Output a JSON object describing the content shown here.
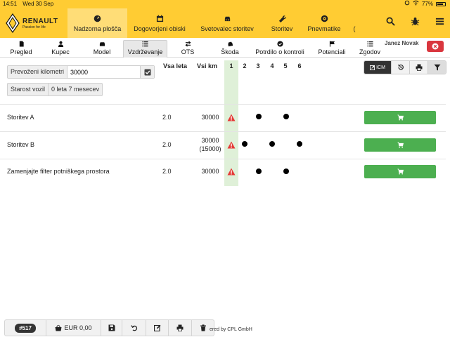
{
  "status_bar": {
    "time": "14:51",
    "date": "Wed 30 Sep",
    "battery": "77%"
  },
  "brand": {
    "name": "RENAULT",
    "slogan": "Passion for life"
  },
  "nav": [
    {
      "label": "Nadzorna plošča",
      "icon": "gauge-icon",
      "active": true
    },
    {
      "label": "Dogovorjeni obiski",
      "icon": "calendar-icon",
      "active": false
    },
    {
      "label": "Svetovalec storitev",
      "icon": "car-front-icon",
      "active": false
    },
    {
      "label": "Storitev",
      "icon": "wrench-icon",
      "active": false
    },
    {
      "label": "Pnevmatike",
      "icon": "tire-icon",
      "active": false
    },
    {
      "label": "(",
      "icon": "",
      "active": false
    }
  ],
  "tabs": [
    {
      "label": "Pregled",
      "icon": "document-icon",
      "active": false
    },
    {
      "label": "Kupec",
      "icon": "user-icon",
      "active": false
    },
    {
      "label": "Model",
      "icon": "car-icon",
      "active": false
    },
    {
      "label": "Vzdrževanje",
      "icon": "list-icon",
      "active": true
    },
    {
      "label": "OTS",
      "icon": "exchange-icon",
      "active": false
    },
    {
      "label": "Škoda",
      "icon": "car-crash-icon",
      "active": false
    },
    {
      "label": "Potrdilo o kontroli",
      "icon": "check-circle-icon",
      "active": false
    },
    {
      "label": "Potenciali",
      "icon": "flag-icon",
      "active": false
    },
    {
      "label": "Zgodov",
      "icon": "list-icon",
      "active": false
    }
  ],
  "user": {
    "name": "Janez Novak"
  },
  "form": {
    "km_label": "Prevoženi kilometri",
    "km_value": "30000",
    "age_label": "Starost vozil",
    "age_value": "0 leta 7 mesecev"
  },
  "columns": {
    "years": "Vsa leta",
    "km": "Vsi km",
    "numbers": [
      "1",
      "2",
      "3",
      "4",
      "5",
      "6"
    ]
  },
  "toolbar": {
    "icm_label": "ICM"
  },
  "services": [
    {
      "name": "Storitev A",
      "years": "2.0",
      "km": "30000",
      "km_sub": "",
      "warning": true,
      "dots": [
        3,
        5
      ]
    },
    {
      "name": "Storitev B",
      "years": "2.0",
      "km": "30000",
      "km_sub": "(15000)",
      "warning": true,
      "dots": [
        2,
        4,
        6
      ]
    },
    {
      "name": "Zamenjajte filter potniškega prostora",
      "years": "2.0",
      "km": "30000",
      "km_sub": "",
      "warning": true,
      "dots": [
        3,
        5
      ]
    }
  ],
  "bottom": {
    "order_no": "#517",
    "basket": "EUR 0,00",
    "powered": "ered by CPL GmbH"
  },
  "colors": {
    "brand_yellow": "#ffcc33",
    "cart_green": "#4caf50",
    "close_red": "#d9363e",
    "highlight_green": "#dff0d8",
    "warning_red": "#e53935"
  }
}
